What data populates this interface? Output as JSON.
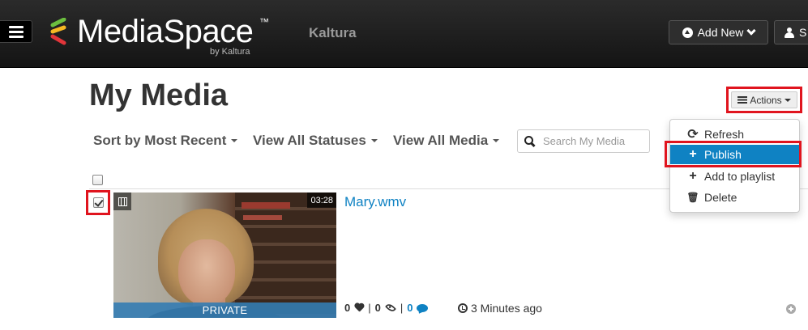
{
  "header": {
    "logo_text": "MediaSpace",
    "logo_tm": "™",
    "logo_byline": "by Kaltura",
    "brand": "Kaltura",
    "add_new_label": "Add New",
    "user_label": "S"
  },
  "page": {
    "title": "My Media"
  },
  "actions": {
    "button_label": "Actions",
    "menu": [
      {
        "label": "Refresh",
        "icon": "refresh-icon"
      },
      {
        "label": "Publish",
        "icon": "plus-icon",
        "highlighted": true
      },
      {
        "label": "Add to playlist",
        "icon": "plus-icon"
      },
      {
        "label": "Delete",
        "icon": "trash-icon"
      }
    ]
  },
  "filters": {
    "sort_label": "Sort by Most Recent",
    "status_label": "View All Statuses",
    "media_label": "View All Media",
    "search_placeholder": "Search My Media"
  },
  "media_items": [
    {
      "title": "Mary.wmv",
      "duration": "03:28",
      "visibility": "PRIVATE",
      "likes": "0",
      "views": "0",
      "comments": "0",
      "time_ago": "3 Minutes ago",
      "selected": true
    }
  ],
  "colors": {
    "accent": "#0f82c3",
    "highlight_outline": "#e0141e",
    "topbar": "#1c1c1c"
  }
}
